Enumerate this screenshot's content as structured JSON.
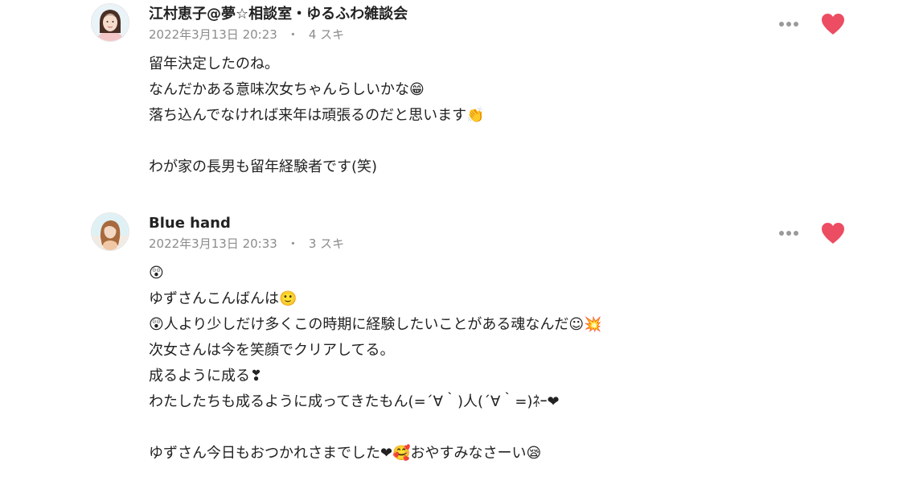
{
  "comments": [
    {
      "author": "江村恵子@夢☆相談室・ゆるふわ雑談会",
      "date": "2022年3月13日 20:23",
      "separator": "・",
      "likes": "4 スキ",
      "liked": true,
      "lines": [
        "留年決定したのね。",
        "なんだかある意味次女ちゃんらしいかな😁",
        "落ち込んでなければ来年は頑張るのだと思います👏",
        "",
        "わが家の長男も留年経験者です(笑)"
      ]
    },
    {
      "author": "Blue hand",
      "date": "2022年3月13日 20:33",
      "separator": "・",
      "likes": "3 スキ",
      "liked": true,
      "lines": [
        "😲",
        "ゆずさんこんばんは🙂",
        "😲人より少しだけ多くこの時期に経験したいことがある魂なんだ☺💥",
        "次女さんは今を笑顔でクリアしてる。",
        "成るように成る❣",
        "わたしたちも成るように成ってきたもん(=´∀｀)人(´∀｀=)ﾈｰ❤",
        "",
        "ゆずさん今日もおつかれさまでした❤🥰おやすみなさーい😪"
      ]
    }
  ],
  "colors": {
    "heart": "#ec4d62",
    "meta_text": "#8c8c8c",
    "body_text": "#222222"
  },
  "icons": {
    "more": "more-horizontal-icon",
    "like": "heart-icon"
  }
}
